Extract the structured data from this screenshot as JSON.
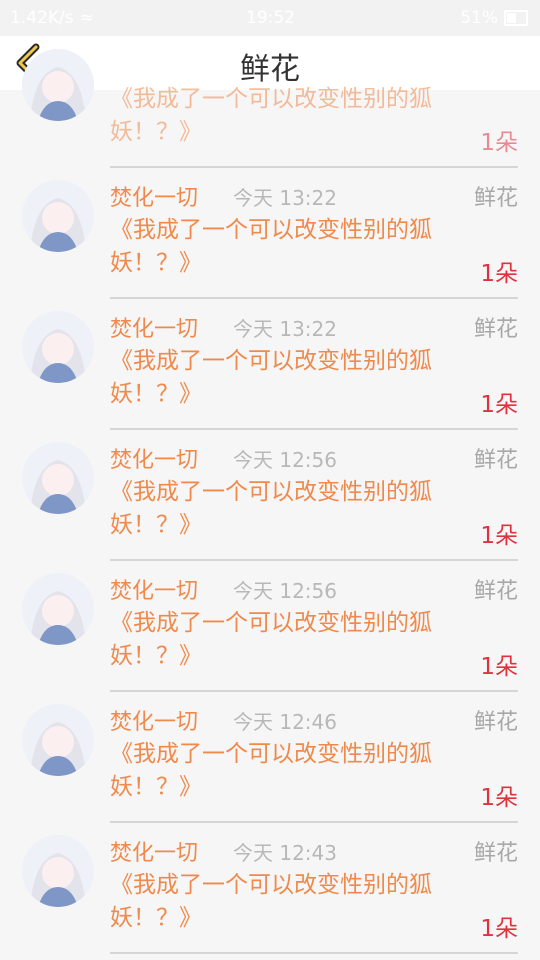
{
  "status_bar": {
    "speed": "1.42K/s",
    "time": "19:52",
    "battery": "51%"
  },
  "header": {
    "title": "鲜花"
  },
  "items": [
    {
      "name": "",
      "time": "",
      "type": "",
      "book": "《我成了一个可以改变性别的狐妖！？》",
      "count": "1朵"
    },
    {
      "name": "焚化一切",
      "time": "今天 13:22",
      "type": "鲜花",
      "book": "《我成了一个可以改变性别的狐妖！？》",
      "count": "1朵"
    },
    {
      "name": "焚化一切",
      "time": "今天 13:22",
      "type": "鲜花",
      "book": "《我成了一个可以改变性别的狐妖！？》",
      "count": "1朵"
    },
    {
      "name": "焚化一切",
      "time": "今天 12:56",
      "type": "鲜花",
      "book": "《我成了一个可以改变性别的狐妖！？》",
      "count": "1朵"
    },
    {
      "name": "焚化一切",
      "time": "今天 12:56",
      "type": "鲜花",
      "book": "《我成了一个可以改变性别的狐妖！？》",
      "count": "1朵"
    },
    {
      "name": "焚化一切",
      "time": "今天 12:46",
      "type": "鲜花",
      "book": "《我成了一个可以改变性别的狐妖！？》",
      "count": "1朵"
    },
    {
      "name": "焚化一切",
      "time": "今天 12:43",
      "type": "鲜花",
      "book": "《我成了一个可以改变性别的狐妖！？》",
      "count": "1朵"
    }
  ]
}
